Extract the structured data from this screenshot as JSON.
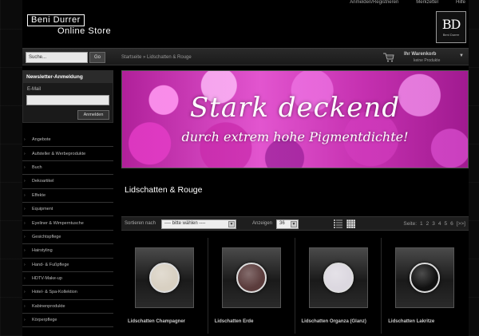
{
  "header": {
    "toplinks": [
      "Anmelden/Registrieren",
      "Merkzettel",
      "Hilfe"
    ],
    "logo_line1": "Beni Durrer",
    "logo_line2": "Online Store",
    "badge_mark": "BD",
    "badge_text": "Beni Durrer"
  },
  "navbar": {
    "search_placeholder": "Suche...",
    "go_label": "Go",
    "breadcrumb": "Startseite » Lidschatten & Rouge",
    "cart_title": "Ihr Warenkorb",
    "cart_sub": "keine Produkte"
  },
  "newsletter": {
    "title": "Newsletter-Anmeldung",
    "email_label": "E-Mail",
    "submit_label": "Anmelden"
  },
  "categories": [
    "Angebote",
    "Aufsteller & Werbeprodukte",
    "Buch",
    "Dekoartikel",
    "Effekte",
    "Equipment",
    "Eyeliner & Wimperntusche",
    "Gesichtspflege",
    "Hairstyling",
    "Hand- & Fußpflege",
    "HDTV-Make-up",
    "Hotel- & Spa-Kollektion",
    "Kabinenprodukte",
    "Körperpflege"
  ],
  "banner": {
    "line1": "Stark deckend",
    "line2": "durch extrem hohe Pigmentdichte!"
  },
  "page_title": "Lidschatten & Rouge",
  "sortbar": {
    "sort_label": "Sortieren nach",
    "sort_value": "---- bitte wählen ----",
    "show_label": "Anzeigen",
    "show_value": "36",
    "page_label": "Seite:",
    "pages": [
      "1",
      "2",
      "3",
      "4",
      "5",
      "6",
      "[>>]"
    ]
  },
  "products": [
    {
      "name": "Lidschatten Champagner",
      "color": "#d8d0c2"
    },
    {
      "name": "Lidschatten Erde",
      "color": "#5b3c3c"
    },
    {
      "name": "Lidschatten Organza (Glanz)",
      "color": "#dcd8e0"
    },
    {
      "name": "Lidschatten Lakritze",
      "color": "#111111"
    }
  ]
}
